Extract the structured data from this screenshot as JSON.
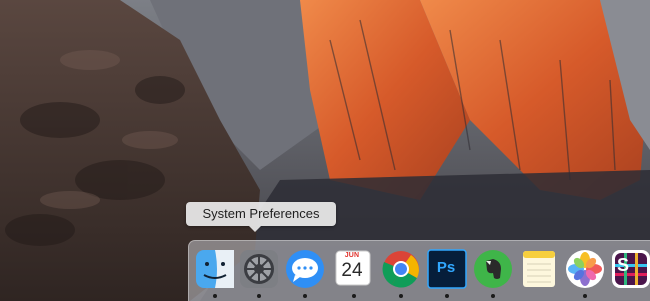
{
  "tooltip": {
    "label": "System Preferences"
  },
  "dock": {
    "items": [
      {
        "icon": "finder-icon",
        "running": true
      },
      {
        "icon": "system-preferences-icon",
        "running": true
      },
      {
        "icon": "messages-icon",
        "running": true
      },
      {
        "icon": "calendar-icon",
        "running": true,
        "month": "JUN",
        "day": "24"
      },
      {
        "icon": "chrome-icon",
        "running": true
      },
      {
        "icon": "photoshop-icon",
        "running": true,
        "label": "Ps"
      },
      {
        "icon": "evernote-icon",
        "running": true
      },
      {
        "icon": "notes-icon",
        "running": false
      },
      {
        "icon": "photos-icon",
        "running": true
      },
      {
        "icon": "slack-icon",
        "running": false,
        "label": "S"
      }
    ]
  },
  "colors": {
    "mountain_orange": "#d8582a",
    "shadow_rock": "#3e302d",
    "sky_snow": "#6b7078"
  }
}
